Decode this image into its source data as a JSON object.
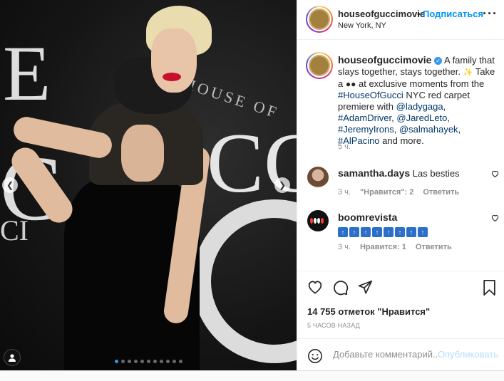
{
  "post": {
    "photo_alt": "",
    "carousel": {
      "count": 11,
      "active_index": 0
    }
  },
  "header": {
    "username": "houseofguccimovie",
    "bullet": "•",
    "follow_label": "Подписаться",
    "location": "New York, NY",
    "more_icon": "more-horizontal-icon"
  },
  "caption": {
    "username": "houseofguccimovie",
    "text_1": "A family that slays together, stays together.",
    "text_2": "Take a",
    "text_3": "at exclusive moments from the",
    "hashtag_1": "#HouseOfGucci",
    "text_4": "NYC red carpet premiere with",
    "mention_1": "@ladygaga",
    "hashtag_2": "#AdamDriver",
    "mention_2": "@JaredLeto",
    "hashtag_3": "#JeremyIrons",
    "mention_3": "@salmahayek",
    "hashtag_4": "#AlPacino",
    "text_5": "and more.",
    "time": "5 ч."
  },
  "comments": [
    {
      "username": "samantha.days",
      "text": "Las besties",
      "time": "3 ч.",
      "likes": "\"Нравится\": 2",
      "reply": "Ответить"
    },
    {
      "username": "boomrevista",
      "flags": [
        "TOP",
        "TOP",
        "TOP",
        "TOP",
        "TOP",
        "TOP",
        "TOP",
        "TOP"
      ],
      "time": "3 ч.",
      "likes": "Нравится: 1",
      "reply": "Ответить"
    }
  ],
  "actions": {
    "like_icon": "heart-icon",
    "comment_icon": "comment-icon",
    "share_icon": "paper-plane-icon",
    "save_icon": "bookmark-icon"
  },
  "likes_text": "14 755 отметок \"Нравится\"",
  "posted_ago": "5 ЧАСОВ НАЗАД",
  "add_comment": {
    "placeholder": "Добавьте комментарий...",
    "post_label": "Опубликовать"
  }
}
